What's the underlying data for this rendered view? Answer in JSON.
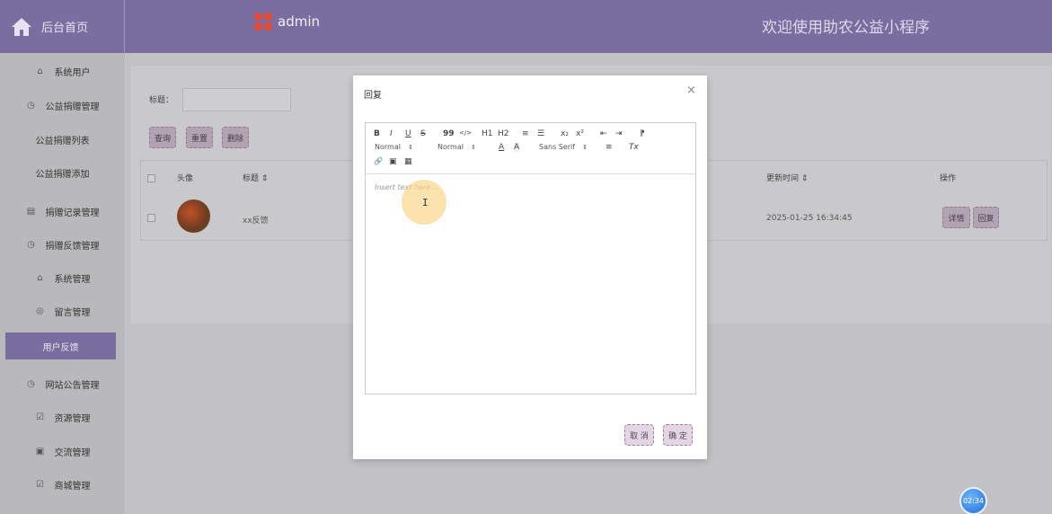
{
  "header": {
    "home_label": "后台首页",
    "admin_label": "admin",
    "welcome": "欢迎使用助农公益小程序"
  },
  "sidebar": {
    "items": [
      {
        "label": "系统用户",
        "icon": "home-outline-icon"
      },
      {
        "label": "公益捐赠管理",
        "icon": "clock-icon"
      },
      {
        "label": "公益捐赠列表",
        "icon": ""
      },
      {
        "label": "公益捐赠添加",
        "icon": ""
      },
      {
        "label": "捐赠记录管理",
        "icon": "calendar-icon"
      },
      {
        "label": "捐赠反馈管理",
        "icon": "clock-icon"
      },
      {
        "label": "系统管理",
        "icon": "home-outline-icon"
      },
      {
        "label": "留言管理",
        "icon": "compass-icon"
      },
      {
        "label": "用户反馈",
        "icon": "",
        "active": true
      },
      {
        "label": "网站公告管理",
        "icon": "clock-icon"
      },
      {
        "label": "资源管理",
        "icon": "checkbox-icon"
      },
      {
        "label": "交流管理",
        "icon": "box-icon"
      },
      {
        "label": "商城管理",
        "icon": "checkbox-icon"
      }
    ]
  },
  "search": {
    "label": "标题：",
    "value": ""
  },
  "toolbar_buttons": {
    "query": "查询",
    "reset": "重置",
    "delete": "删除"
  },
  "table": {
    "headers": {
      "avatar": "头像",
      "title": "标题 ⇕",
      "updated": "更新时间 ⇕",
      "actions": "操作"
    },
    "rows": [
      {
        "title": "xx反馈",
        "updated": "2025-01-25 16:34:45",
        "detail": "详情",
        "reply": "回复"
      }
    ]
  },
  "modal": {
    "title": "回复",
    "close": "×",
    "editor": {
      "placeholder": "Insert text here ...",
      "header_select": "Normal",
      "size_select": "Normal",
      "font_select": "Sans Serif",
      "tools": {
        "bold": "B",
        "italic": "I",
        "underline": "U",
        "strike": "S",
        "quote": "99",
        "code": "</>",
        "h1": "H1",
        "h2": "H2",
        "ordered": "≡",
        "bullet": "☰",
        "sub": "x₂",
        "sup": "x²",
        "outdent": "⇤",
        "indent": "⇥",
        "direction": "⁋",
        "color": "A",
        "background": "A",
        "align": "≡",
        "clean": "Tx",
        "link": "🔗",
        "image": "▣",
        "video": "▦"
      }
    },
    "cancel": "取 消",
    "confirm": "确 定"
  },
  "timer": "02:34",
  "colors": {
    "header_bg": "#7a6ea1",
    "sidebar_active": "#7a6ea1",
    "button_bg": "#e3d6e3"
  }
}
